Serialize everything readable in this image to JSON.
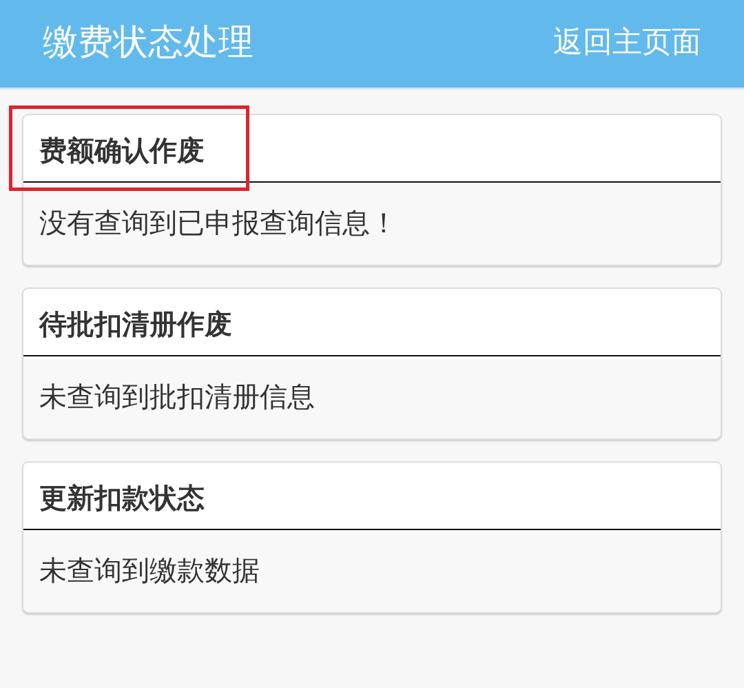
{
  "header": {
    "title": "缴费状态处理",
    "back_link": "返回主页面"
  },
  "cards": [
    {
      "title": "费额确认作废",
      "message": "没有查询到已申报查询信息！",
      "highlighted": true
    },
    {
      "title": "待批扣清册作废",
      "message": "未查询到批扣清册信息",
      "highlighted": false
    },
    {
      "title": "更新扣款状态",
      "message": "未查询到缴款数据",
      "highlighted": false
    }
  ]
}
